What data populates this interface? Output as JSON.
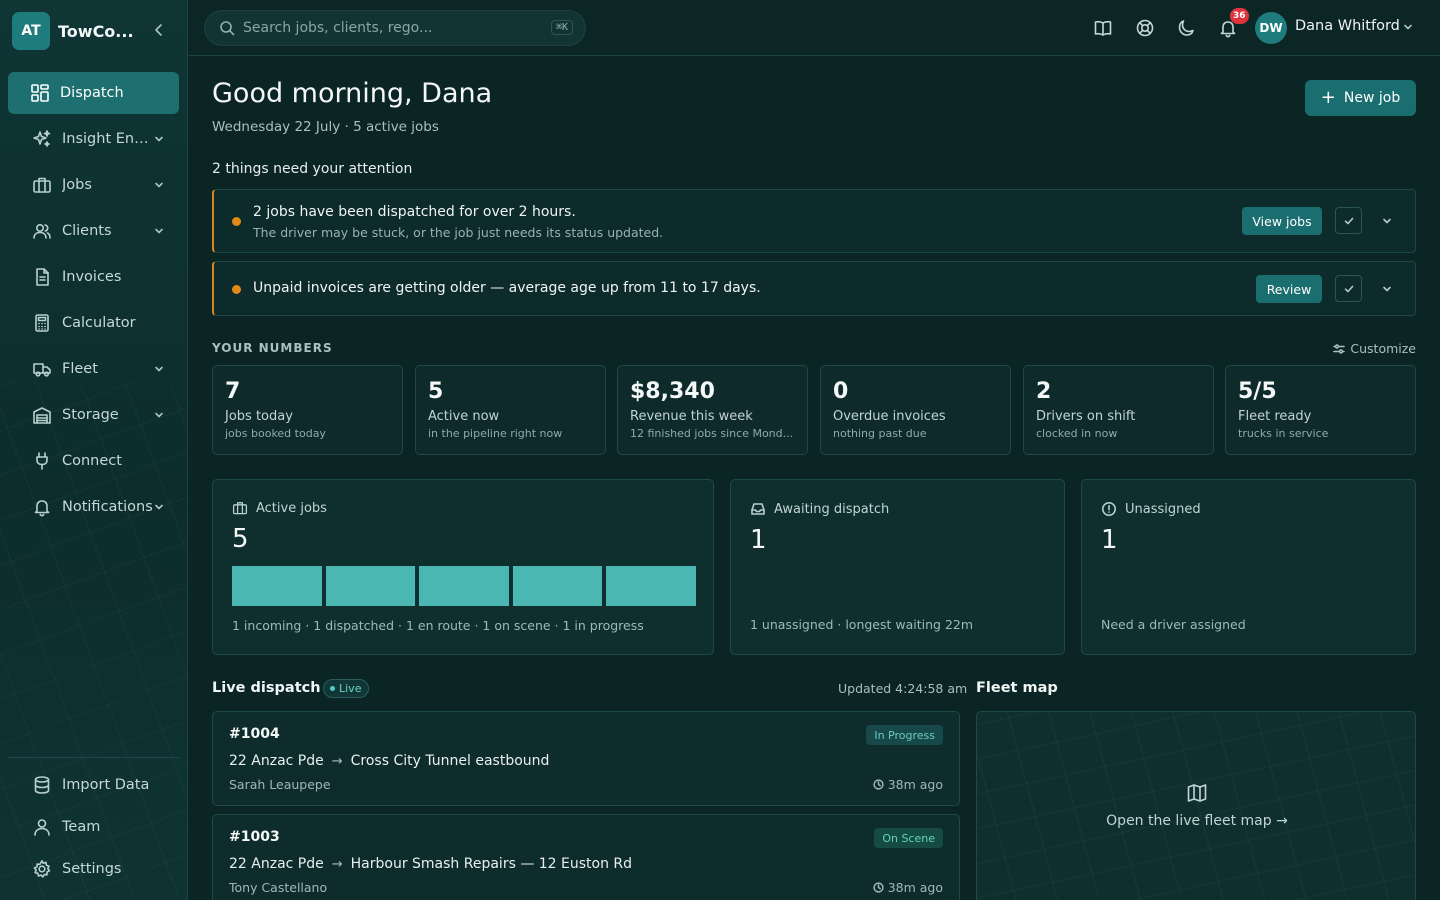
{
  "brand": {
    "initials": "AT",
    "name": "TowCo..."
  },
  "sidebar": {
    "items": [
      {
        "label": "Dispatch",
        "icon": "dashboard-icon",
        "active": true,
        "has_chevron": false
      },
      {
        "label": "Insight Eng...",
        "icon": "sparkles-icon",
        "active": false,
        "has_chevron": true
      },
      {
        "label": "Jobs",
        "icon": "briefcase-icon",
        "active": false,
        "has_chevron": true
      },
      {
        "label": "Clients",
        "icon": "users-icon",
        "active": false,
        "has_chevron": true
      },
      {
        "label": "Invoices",
        "icon": "document-icon",
        "active": false,
        "has_chevron": false
      },
      {
        "label": "Calculator",
        "icon": "calculator-icon",
        "active": false,
        "has_chevron": false
      },
      {
        "label": "Fleet",
        "icon": "truck-icon",
        "active": false,
        "has_chevron": true
      },
      {
        "label": "Storage",
        "icon": "warehouse-icon",
        "active": false,
        "has_chevron": true
      },
      {
        "label": "Connect",
        "icon": "plug-icon",
        "active": false,
        "has_chevron": false
      },
      {
        "label": "Notifications",
        "icon": "bell-icon",
        "active": false,
        "has_chevron": true
      }
    ],
    "bottom_items": [
      {
        "label": "Import Data",
        "icon": "database-icon"
      },
      {
        "label": "Team",
        "icon": "user-icon"
      },
      {
        "label": "Settings",
        "icon": "gear-icon"
      }
    ]
  },
  "header": {
    "search_placeholder": "Search jobs, clients, rego...",
    "search_shortcut": "⌘K",
    "notification_count": "36",
    "user_initials": "DW",
    "user_name": "Dana Whitford"
  },
  "main": {
    "greeting": "Good morning, Dana",
    "subline": "Wednesday 22 July · 5 active jobs",
    "new_job_label": "New job",
    "attention_title": "2 things need your attention",
    "alerts": [
      {
        "title": "2 jobs have been dispatched for over 2 hours.",
        "description": "The driver may be stuck, or the job just needs its status updated.",
        "action_label": "View jobs"
      },
      {
        "title": "Unpaid invoices are getting older — average age up from 11 to 17 days.",
        "description": "",
        "action_label": "Review"
      }
    ],
    "numbers_label": "YOUR NUMBERS",
    "customize_label": "Customize",
    "stats": [
      {
        "value": "7",
        "label": "Jobs today",
        "sub": "jobs booked today"
      },
      {
        "value": "5",
        "label": "Active now",
        "sub": "in the pipeline right now"
      },
      {
        "value": "$8,340",
        "label": "Revenue this week",
        "sub": "12 finished jobs since Mond..."
      },
      {
        "value": "0",
        "label": "Overdue invoices",
        "sub": "nothing past due"
      },
      {
        "value": "2",
        "label": "Drivers on shift",
        "sub": "clocked in now"
      },
      {
        "value": "5/5",
        "label": "Fleet ready",
        "sub": "trucks in service"
      }
    ],
    "panels": {
      "active_jobs": {
        "title": "Active jobs",
        "value": "5",
        "segments": 5,
        "footer": "1 incoming · 1 dispatched · 1 en route · 1 on scene · 1 in progress"
      },
      "awaiting": {
        "title": "Awaiting dispatch",
        "value": "1",
        "footer": "1 unassigned · longest waiting 22m"
      },
      "unassigned": {
        "title": "Unassigned",
        "value": "1",
        "footer": "Need a driver assigned"
      }
    },
    "live": {
      "title": "Live dispatch",
      "badge": "Live",
      "updated": "Updated 4:24:58 am",
      "jobs": [
        {
          "id": "#1004",
          "from": "22 Anzac Pde",
          "to": "Cross City Tunnel eastbound",
          "driver": "Sarah Leaupepe",
          "status": "In Progress",
          "ago": "38m ago"
        },
        {
          "id": "#1003",
          "from": "22 Anzac Pde",
          "to": "Harbour Smash Repairs — 12 Euston Rd",
          "driver": "Tony Castellano",
          "status": "On Scene",
          "ago": "38m ago"
        }
      ]
    },
    "fleet_map": {
      "title": "Fleet map",
      "link": "Open the live fleet map →"
    }
  },
  "colors": {
    "accent": "#1d6f70",
    "bar": "#4ab7b3",
    "warning": "#e28a18",
    "badge_red": "#e0343c"
  }
}
